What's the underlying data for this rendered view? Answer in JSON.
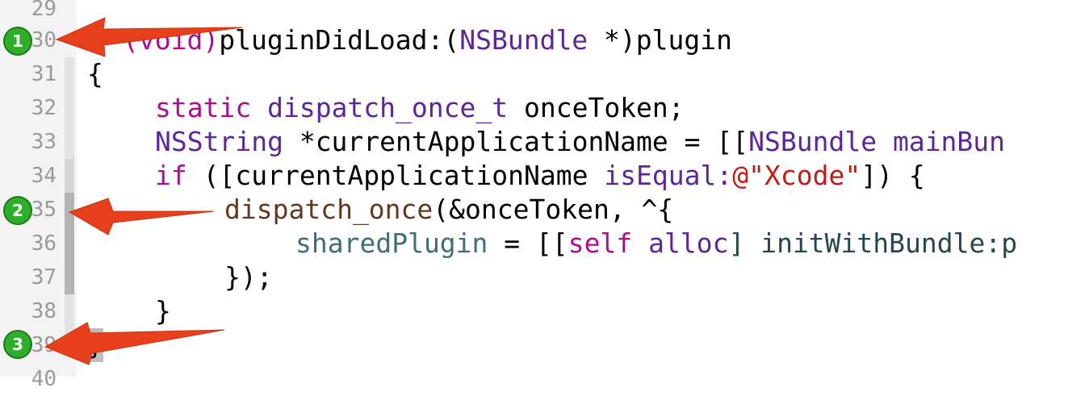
{
  "editor": {
    "line_numbers": [
      "29",
      "30",
      "31",
      "32",
      "33",
      "34",
      "35",
      "36",
      "37",
      "38",
      "39",
      "40"
    ],
    "lines": {
      "l30": {
        "t1": "(void)",
        "t2": "pluginDidLoad:(",
        "t3": "NSBundle",
        "t4": " *)plugin"
      },
      "l31": {
        "t1": "{"
      },
      "l32": {
        "t1": "static",
        "t2": " ",
        "t3": "dispatch_once_t",
        "t4": " onceToken;"
      },
      "l33": {
        "t1": "NSString",
        "t2": " *currentApplicationName = [[",
        "t3": "NSBundle",
        "t4": " ",
        "t5": "mainBun"
      },
      "l34": {
        "t1": "if",
        "t2": " ([currentApplicationName ",
        "t3": "isEqual:",
        "t4": "@\"Xcode\"",
        "t5": "]) {"
      },
      "l35": {
        "t1": "dispatch_once",
        "t2": "(&onceToken, ^{"
      },
      "l36": {
        "t1": "sharedPlugin",
        "t2": " = [[",
        "t3": "self",
        "t4": " ",
        "t5": "alloc",
        "t6": "] initWithBundle:p"
      },
      "l37": {
        "t1": "});"
      },
      "l38": {
        "t1": "}"
      },
      "l39": {
        "t1": "}"
      }
    }
  },
  "annotations": {
    "badges": [
      "1",
      "2",
      "3"
    ],
    "arrow_color": "#e8401c",
    "badge_color": "#2fae2c"
  }
}
